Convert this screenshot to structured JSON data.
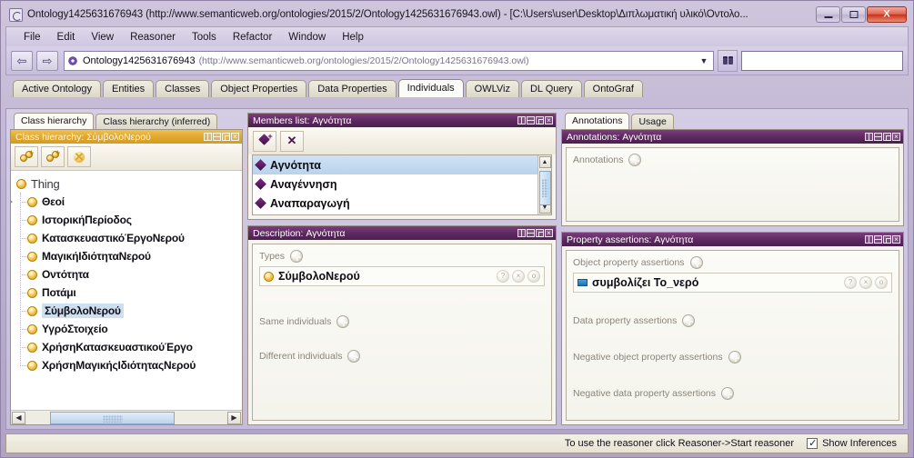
{
  "window": {
    "title": "Ontology1425631676943 (http://www.semanticweb.org/ontologies/2015/2/Ontology1425631676943.owl) - [C:\\Users\\user\\Desktop\\Διπλωματική υλικό\\Οντολο...",
    "app_icon": "protege-icon",
    "minimize_label": "",
    "maximize_label": "",
    "close_label": "X"
  },
  "menu": {
    "items": [
      "File",
      "Edit",
      "View",
      "Reasoner",
      "Tools",
      "Refactor",
      "Window",
      "Help"
    ]
  },
  "toolbar": {
    "back_glyph": "⇦",
    "forward_glyph": "⇨",
    "ontology_name": "Ontology1425631676943",
    "ontology_uri": "(http://www.semanticweb.org/ontologies/2015/2/Ontology1425631676943.owl)",
    "dropdown_glyph": "▼",
    "search_icon": "binoculars-icon",
    "search_value": "",
    "search_placeholder": ""
  },
  "tabs": {
    "items": [
      {
        "label": "Active Ontology",
        "active": false
      },
      {
        "label": "Entities",
        "active": false
      },
      {
        "label": "Classes",
        "active": false
      },
      {
        "label": "Object Properties",
        "active": false
      },
      {
        "label": "Data Properties",
        "active": false
      },
      {
        "label": "Individuals",
        "active": true
      },
      {
        "label": "OWLViz",
        "active": false
      },
      {
        "label": "DL Query",
        "active": false
      },
      {
        "label": "OntoGraf",
        "active": false
      }
    ]
  },
  "class_hierarchy": {
    "subtabs": [
      {
        "label": "Class hierarchy",
        "active": true
      },
      {
        "label": "Class hierarchy (inferred)",
        "active": false
      }
    ],
    "panel_title": "Class hierarchy: ΣύμβολοΝερού",
    "buttons": [
      {
        "name": "add-subclass-button",
        "icon": "add-subclass-icon"
      },
      {
        "name": "add-sibling-class-button",
        "icon": "add-sibling-class-icon"
      },
      {
        "name": "delete-class-button",
        "icon": "delete-class-icon"
      }
    ],
    "tree": [
      {
        "label": "Thing",
        "level": 0,
        "expandable": false,
        "selected": false
      },
      {
        "label": "Θεοί",
        "level": 1,
        "expandable": true,
        "selected": false
      },
      {
        "label": "ΙστορικήΠερίοδος",
        "level": 1,
        "expandable": false,
        "selected": false
      },
      {
        "label": "ΚατασκευαστικόΈργοΝερού",
        "level": 1,
        "expandable": false,
        "selected": false
      },
      {
        "label": "ΜαγικήΙδιότηταΝερού",
        "level": 1,
        "expandable": false,
        "selected": false
      },
      {
        "label": "Οντότητα",
        "level": 1,
        "expandable": false,
        "selected": false
      },
      {
        "label": "Ποτάμι",
        "level": 1,
        "expandable": false,
        "selected": false
      },
      {
        "label": "ΣύμβολοΝερού",
        "level": 1,
        "expandable": false,
        "selected": true
      },
      {
        "label": "ΥγρόΣτοιχείο",
        "level": 1,
        "expandable": false,
        "selected": false
      },
      {
        "label": "ΧρήσηΚατασκευαστικούΈργο",
        "level": 1,
        "expandable": false,
        "selected": false
      },
      {
        "label": "ΧρήσηΜαγικήςΙδιότηταςΝερού",
        "level": 1,
        "expandable": false,
        "selected": false
      }
    ],
    "scroll_left_glyph": "◀",
    "scroll_right_glyph": "▶"
  },
  "members_list": {
    "panel_title": "Members list: Αγνότητα",
    "buttons": [
      {
        "name": "add-individual-button",
        "icon": "add-individual-icon"
      },
      {
        "name": "delete-individual-button",
        "icon": "delete-individual-icon"
      }
    ],
    "items": [
      {
        "label": "Αγνότητα",
        "selected": true
      },
      {
        "label": "Αναγέννηση",
        "selected": false
      },
      {
        "label": "Αναπαραγωγή",
        "selected": false
      }
    ],
    "scroll_up_glyph": "▲",
    "scroll_down_glyph": "▼"
  },
  "description": {
    "panel_title": "Description: Αγνότητα",
    "sections": [
      {
        "label": "Types",
        "name": "types-section"
      },
      {
        "label": "Same individuals",
        "name": "same-individuals-section"
      },
      {
        "label": "Different individuals",
        "name": "different-individuals-section"
      }
    ],
    "type_value": "ΣύμβολοΝερού",
    "entry_actions": [
      "?",
      "×",
      "o"
    ]
  },
  "annotations": {
    "tabs": [
      {
        "label": "Annotations",
        "active": true
      },
      {
        "label": "Usage",
        "active": false
      }
    ],
    "panel_title": "Annotations: Αγνότητα",
    "section_label": "Annotations"
  },
  "property_assertions": {
    "panel_title": "Property assertions: Αγνότητα",
    "sections": [
      {
        "label": "Object property assertions",
        "name": "object-property-assertions-section"
      },
      {
        "label": "Data property assertions",
        "name": "data-property-assertions-section"
      },
      {
        "label": "Negative object property assertions",
        "name": "negative-object-property-assertions-section"
      },
      {
        "label": "Negative data property assertions",
        "name": "negative-data-property-assertions-section"
      }
    ],
    "assertion_value": "συμβολίζει Το_νερό",
    "entry_actions": [
      "?",
      "×",
      "o"
    ]
  },
  "statusbar": {
    "reasoner_hint": "To use the reasoner click Reasoner->Start reasoner",
    "show_inferences_label": "Show Inferences",
    "show_inferences_checked": true
  },
  "colors": {
    "purple_header": "#5e2a60",
    "gold_header": "#e0a830",
    "selection_blue": "#c3daf0",
    "individual_purple": "#5b1a63",
    "class_gold": "#f0c04a"
  }
}
